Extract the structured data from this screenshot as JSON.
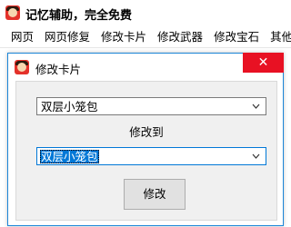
{
  "app": {
    "title": "记忆辅助，完全免费"
  },
  "menu": {
    "items": [
      "网页",
      "网页修复",
      "修改卡片",
      "修改武器",
      "修改宝石",
      "其他"
    ]
  },
  "dialog": {
    "title": "修改卡片",
    "close_glyph": "✕",
    "source_select": {
      "value": "双层小笼包"
    },
    "target_label": "修改到",
    "target_select": {
      "value": "双层小笼包"
    },
    "modify_button": "修改"
  },
  "colors": {
    "close_button": "#e81123",
    "selection": "#0078d7",
    "dialog_border": "#1d86d8"
  }
}
